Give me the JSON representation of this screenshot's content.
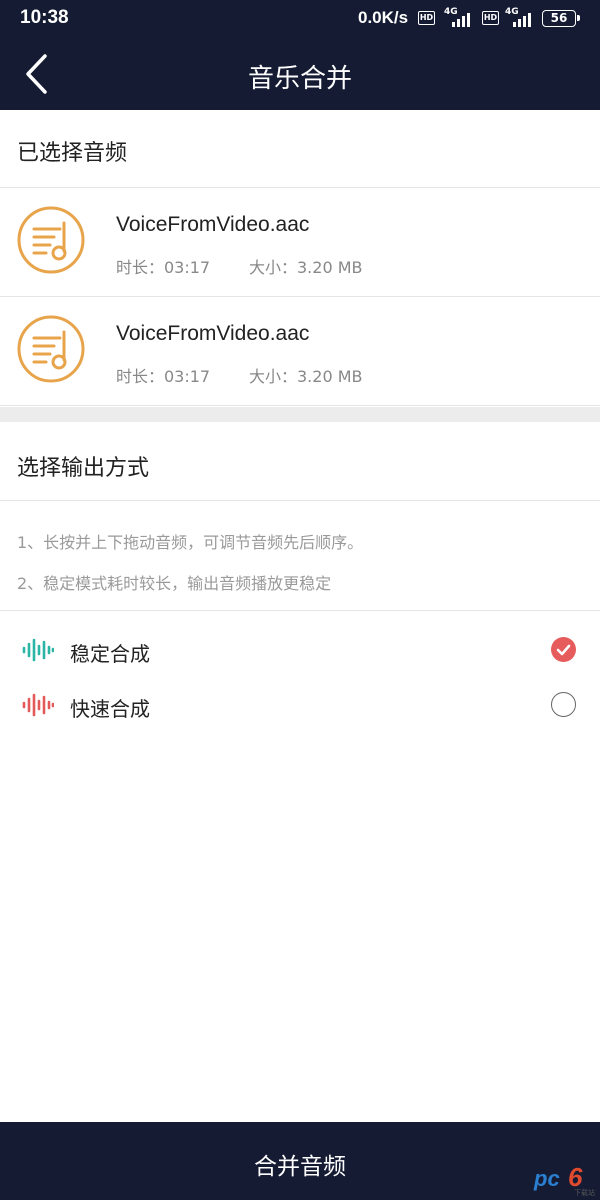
{
  "status_bar": {
    "time": "10:38",
    "net_speed": "0.0K/s",
    "hd1": "HD",
    "net1": "4G",
    "hd2": "HD",
    "net2": "4G",
    "battery": "56"
  },
  "nav": {
    "title": "音乐合并",
    "back_icon": "chevron-left-icon"
  },
  "selected": {
    "header": "已选择音频",
    "files": [
      {
        "name": "VoiceFromVideo.aac",
        "duration": "时长：03:17",
        "size": "大小：3.20 MB"
      },
      {
        "name": "VoiceFromVideo.aac",
        "duration": "时长：03:17",
        "size": "大小：3.20 MB"
      }
    ]
  },
  "output": {
    "header": "选择输出方式",
    "tips": [
      "1、长按并上下拖动音频，可调节音频先后顺序。",
      "2、稳定模式耗时较长，输出音频播放更稳定"
    ],
    "options": [
      {
        "label": "稳定合成",
        "selected": true,
        "color": "#2bb5a5"
      },
      {
        "label": "快速合成",
        "selected": false,
        "color": "#e45a5a"
      }
    ]
  },
  "colors": {
    "bar_bg": "#141b33",
    "accent": "#e65b5b",
    "music_icon": "#e8a44a"
  },
  "bottom": {
    "merge_label": "合并音频"
  },
  "watermark": {
    "brand_pc": "pc",
    "brand_six": "6",
    "brand_sub": "下载站"
  }
}
